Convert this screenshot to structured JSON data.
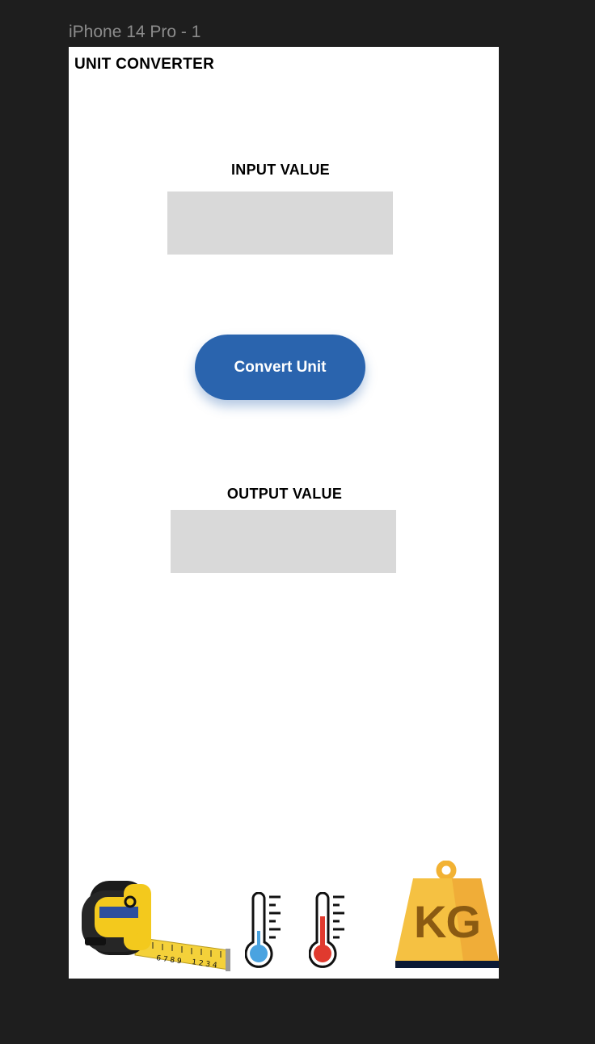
{
  "frame": {
    "label": "iPhone 14 Pro - 1"
  },
  "app": {
    "title": "UNIT CONVERTER"
  },
  "input": {
    "label": "INPUT VALUE",
    "value": ""
  },
  "button": {
    "label": "Convert Unit"
  },
  "output": {
    "label": "OUTPUT VALUE",
    "value": ""
  },
  "images": {
    "tape_measure": "tape-measure-icon",
    "thermometer_cold": "thermometer-cold-icon",
    "thermometer_hot": "thermometer-hot-icon",
    "weight": {
      "icon": "kg-weight-icon",
      "text": "KG"
    }
  },
  "colors": {
    "background": "#1e1e1e",
    "screen": "#ffffff",
    "field": "#d9d9d9",
    "accent": "#2a64ae"
  }
}
